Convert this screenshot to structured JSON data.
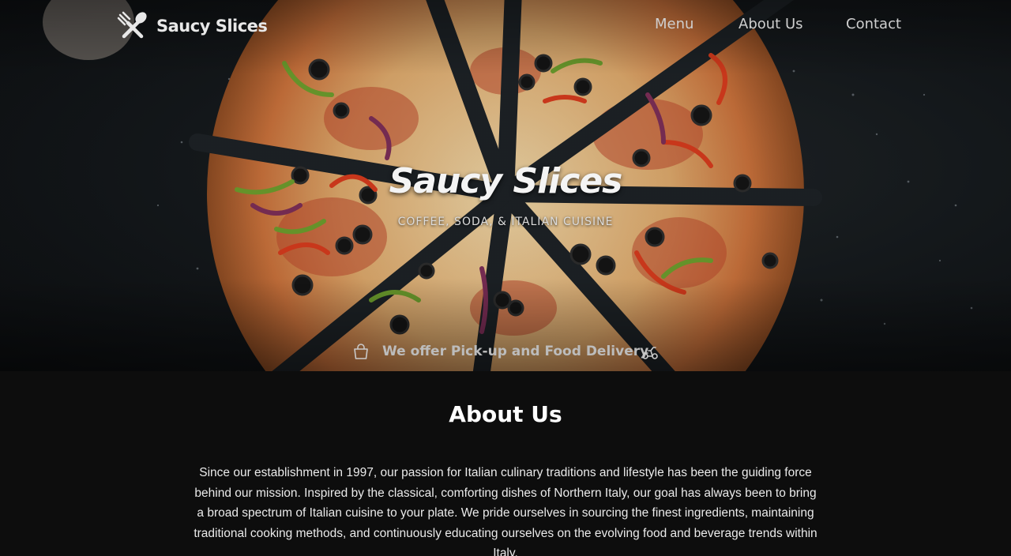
{
  "brand": {
    "name": "Saucy Slices",
    "icon": "fork-spoon-icon"
  },
  "nav": {
    "items": [
      {
        "label": "Menu"
      },
      {
        "label": "About Us"
      },
      {
        "label": "Contact"
      }
    ]
  },
  "hero": {
    "title": "Saucy Slices",
    "subtitle": "COFFEE, SODA, & ITALIAN CUISINE",
    "background": "pizza-photo",
    "delivery": {
      "text": "We offer Pick-up and Food Delivery",
      "left_icon": "shopping-bag-icon",
      "right_icon": "scooter-icon"
    }
  },
  "about": {
    "heading": "About Us",
    "body": "Since our establishment in 1997, our passion for Italian culinary traditions and lifestyle has been the guiding force behind our mission. Inspired by the classical, comforting dishes of Northern Italy, our goal has always been to bring a broad spectrum of Italian cuisine to your plate. We pride ourselves in sourcing the finest ingredients, maintaining traditional cooking methods, and continuously educating ourselves on the evolving food and beverage trends within Italy."
  },
  "colors": {
    "page_background": "#0d0d0d",
    "text": "#ffffff",
    "nav_text": "#cfcfcf",
    "crust": "#c98a4a",
    "sauce": "#c9432b",
    "cheese": "#e8cf9a"
  }
}
